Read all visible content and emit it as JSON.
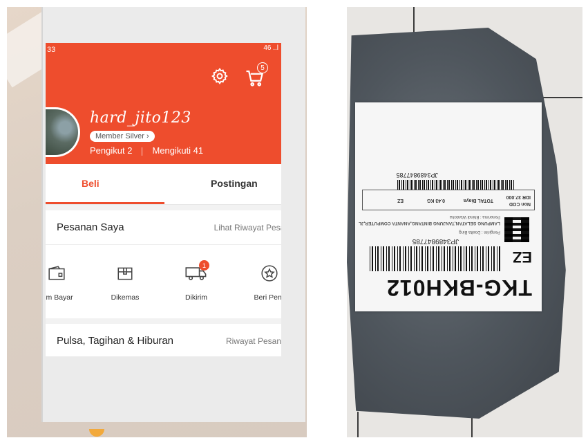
{
  "left_photo": {
    "status_bar": {
      "left": "33",
      "right": "46 ..l"
    },
    "header": {
      "cart_badge": "5",
      "username": "hard_jito123",
      "member_badge": "Member Silver",
      "followers": "Pengikut 2",
      "following": "Mengikuti 41"
    },
    "tabs": [
      {
        "label": "Beli"
      },
      {
        "label": "Postingan"
      }
    ],
    "orders": {
      "title": "Pesanan Saya",
      "link": "Lihat Riwayat Pesan"
    },
    "order_icons": [
      {
        "icon": "wallet-icon",
        "label": "lum Bayar"
      },
      {
        "icon": "box-icon",
        "label": "Dikemas"
      },
      {
        "icon": "truck-icon",
        "label": "Dikirim",
        "badge": "1"
      },
      {
        "icon": "star-icon",
        "label": "Beri Penil"
      }
    ],
    "bills": {
      "title": "Pulsa, Tagihan & Hiburan",
      "link": "Riwayat Pesan"
    },
    "colors": {
      "accent": "#ee4d2d"
    }
  },
  "right_photo": {
    "label": {
      "route_code": "TKG-BKH012",
      "zone": "EZ",
      "tracking": "JP3489847785",
      "tracking_2": "JP3489847785",
      "total_label": "TOTAL Biaya",
      "total_value": "IDR 37.000",
      "cod": "Non COD",
      "recipient": "Penerima : Bhindi Wardoha",
      "company": "LAMPUNG SELATAN,TANJUNG BINTANG,ANANTA COMPUTER,JL",
      "sender": "Pengirim : Doelta Bing",
      "weight": "0.43 KG",
      "service": "EZ"
    }
  }
}
